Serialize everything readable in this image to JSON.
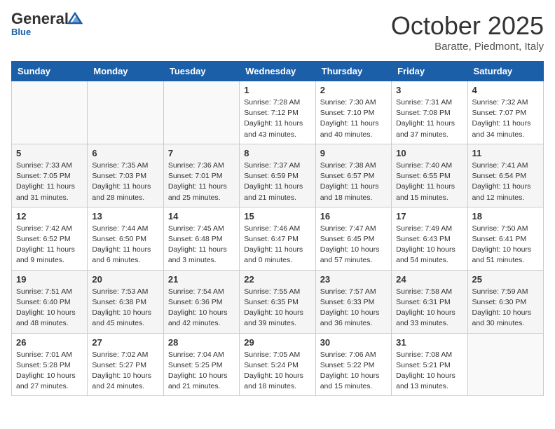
{
  "header": {
    "logo_general": "General",
    "logo_blue": "Blue",
    "month": "October 2025",
    "location": "Baratte, Piedmont, Italy"
  },
  "weekdays": [
    "Sunday",
    "Monday",
    "Tuesday",
    "Wednesday",
    "Thursday",
    "Friday",
    "Saturday"
  ],
  "weeks": [
    [
      {
        "day": "",
        "info": ""
      },
      {
        "day": "",
        "info": ""
      },
      {
        "day": "",
        "info": ""
      },
      {
        "day": "1",
        "info": "Sunrise: 7:28 AM\nSunset: 7:12 PM\nDaylight: 11 hours and 43 minutes."
      },
      {
        "day": "2",
        "info": "Sunrise: 7:30 AM\nSunset: 7:10 PM\nDaylight: 11 hours and 40 minutes."
      },
      {
        "day": "3",
        "info": "Sunrise: 7:31 AM\nSunset: 7:08 PM\nDaylight: 11 hours and 37 minutes."
      },
      {
        "day": "4",
        "info": "Sunrise: 7:32 AM\nSunset: 7:07 PM\nDaylight: 11 hours and 34 minutes."
      }
    ],
    [
      {
        "day": "5",
        "info": "Sunrise: 7:33 AM\nSunset: 7:05 PM\nDaylight: 11 hours and 31 minutes."
      },
      {
        "day": "6",
        "info": "Sunrise: 7:35 AM\nSunset: 7:03 PM\nDaylight: 11 hours and 28 minutes."
      },
      {
        "day": "7",
        "info": "Sunrise: 7:36 AM\nSunset: 7:01 PM\nDaylight: 11 hours and 25 minutes."
      },
      {
        "day": "8",
        "info": "Sunrise: 7:37 AM\nSunset: 6:59 PM\nDaylight: 11 hours and 21 minutes."
      },
      {
        "day": "9",
        "info": "Sunrise: 7:38 AM\nSunset: 6:57 PM\nDaylight: 11 hours and 18 minutes."
      },
      {
        "day": "10",
        "info": "Sunrise: 7:40 AM\nSunset: 6:55 PM\nDaylight: 11 hours and 15 minutes."
      },
      {
        "day": "11",
        "info": "Sunrise: 7:41 AM\nSunset: 6:54 PM\nDaylight: 11 hours and 12 minutes."
      }
    ],
    [
      {
        "day": "12",
        "info": "Sunrise: 7:42 AM\nSunset: 6:52 PM\nDaylight: 11 hours and 9 minutes."
      },
      {
        "day": "13",
        "info": "Sunrise: 7:44 AM\nSunset: 6:50 PM\nDaylight: 11 hours and 6 minutes."
      },
      {
        "day": "14",
        "info": "Sunrise: 7:45 AM\nSunset: 6:48 PM\nDaylight: 11 hours and 3 minutes."
      },
      {
        "day": "15",
        "info": "Sunrise: 7:46 AM\nSunset: 6:47 PM\nDaylight: 11 hours and 0 minutes."
      },
      {
        "day": "16",
        "info": "Sunrise: 7:47 AM\nSunset: 6:45 PM\nDaylight: 10 hours and 57 minutes."
      },
      {
        "day": "17",
        "info": "Sunrise: 7:49 AM\nSunset: 6:43 PM\nDaylight: 10 hours and 54 minutes."
      },
      {
        "day": "18",
        "info": "Sunrise: 7:50 AM\nSunset: 6:41 PM\nDaylight: 10 hours and 51 minutes."
      }
    ],
    [
      {
        "day": "19",
        "info": "Sunrise: 7:51 AM\nSunset: 6:40 PM\nDaylight: 10 hours and 48 minutes."
      },
      {
        "day": "20",
        "info": "Sunrise: 7:53 AM\nSunset: 6:38 PM\nDaylight: 10 hours and 45 minutes."
      },
      {
        "day": "21",
        "info": "Sunrise: 7:54 AM\nSunset: 6:36 PM\nDaylight: 10 hours and 42 minutes."
      },
      {
        "day": "22",
        "info": "Sunrise: 7:55 AM\nSunset: 6:35 PM\nDaylight: 10 hours and 39 minutes."
      },
      {
        "day": "23",
        "info": "Sunrise: 7:57 AM\nSunset: 6:33 PM\nDaylight: 10 hours and 36 minutes."
      },
      {
        "day": "24",
        "info": "Sunrise: 7:58 AM\nSunset: 6:31 PM\nDaylight: 10 hours and 33 minutes."
      },
      {
        "day": "25",
        "info": "Sunrise: 7:59 AM\nSunset: 6:30 PM\nDaylight: 10 hours and 30 minutes."
      }
    ],
    [
      {
        "day": "26",
        "info": "Sunrise: 7:01 AM\nSunset: 5:28 PM\nDaylight: 10 hours and 27 minutes."
      },
      {
        "day": "27",
        "info": "Sunrise: 7:02 AM\nSunset: 5:27 PM\nDaylight: 10 hours and 24 minutes."
      },
      {
        "day": "28",
        "info": "Sunrise: 7:04 AM\nSunset: 5:25 PM\nDaylight: 10 hours and 21 minutes."
      },
      {
        "day": "29",
        "info": "Sunrise: 7:05 AM\nSunset: 5:24 PM\nDaylight: 10 hours and 18 minutes."
      },
      {
        "day": "30",
        "info": "Sunrise: 7:06 AM\nSunset: 5:22 PM\nDaylight: 10 hours and 15 minutes."
      },
      {
        "day": "31",
        "info": "Sunrise: 7:08 AM\nSunset: 5:21 PM\nDaylight: 10 hours and 13 minutes."
      },
      {
        "day": "",
        "info": ""
      }
    ]
  ]
}
